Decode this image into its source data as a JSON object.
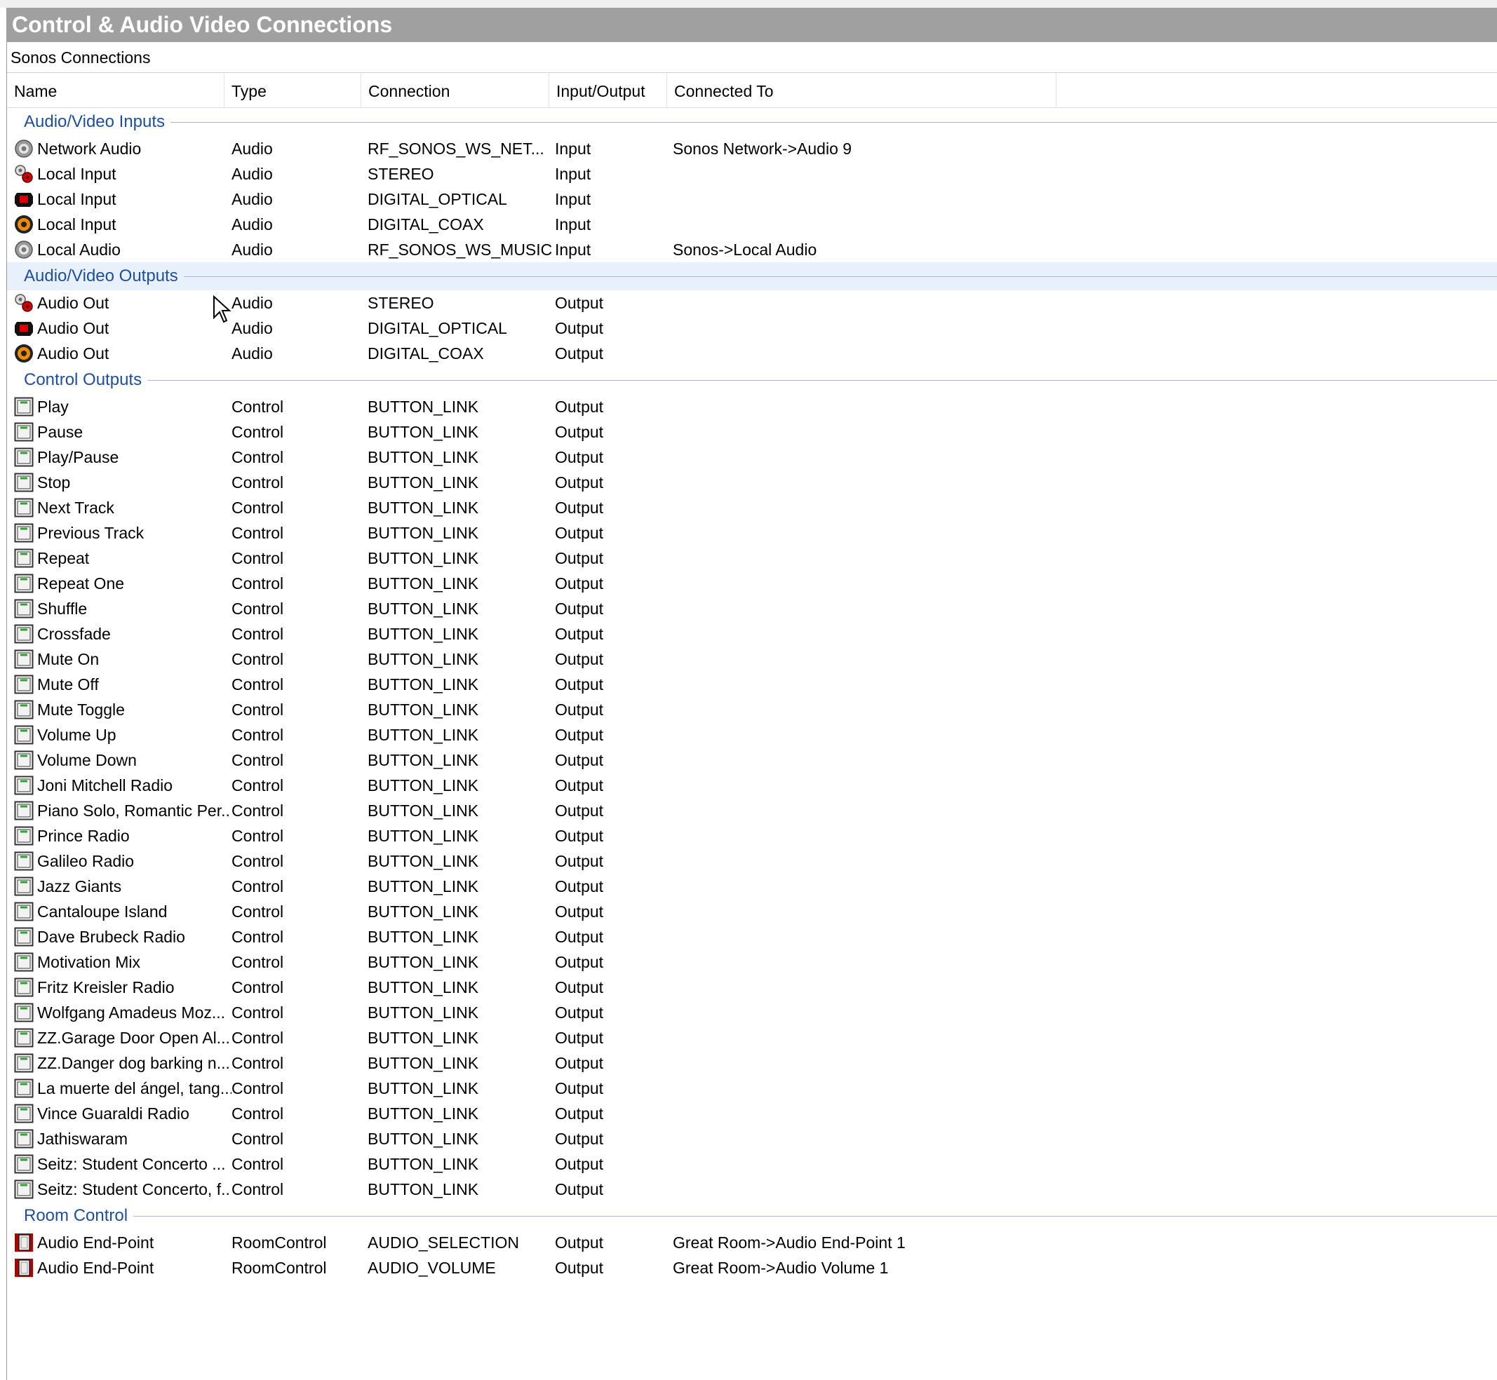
{
  "window": {
    "title": "Control & Audio Video Connections",
    "subtitle": "Sonos Connections"
  },
  "columns": [
    {
      "label": "Name"
    },
    {
      "label": "Type"
    },
    {
      "label": "Connection"
    },
    {
      "label": "Input/Output"
    },
    {
      "label": "Connected To"
    }
  ],
  "groups": [
    {
      "label": "Audio/Video Inputs",
      "rows": [
        {
          "icon": "network-audio-icon",
          "name": "Network Audio",
          "type": "Audio",
          "connection": "RF_SONOS_WS_NET...",
          "io": "Input",
          "connected_to": "Sonos Network->Audio 9"
        },
        {
          "icon": "stereo-jack-icon",
          "name": "Local Input",
          "type": "Audio",
          "connection": "STEREO",
          "io": "Input",
          "connected_to": ""
        },
        {
          "icon": "optical-icon",
          "name": "Local Input",
          "type": "Audio",
          "connection": "DIGITAL_OPTICAL",
          "io": "Input",
          "connected_to": ""
        },
        {
          "icon": "coax-icon",
          "name": "Local Input",
          "type": "Audio",
          "connection": "DIGITAL_COAX",
          "io": "Input",
          "connected_to": ""
        },
        {
          "icon": "network-audio-icon",
          "name": "Local Audio",
          "type": "Audio",
          "connection": "RF_SONOS_WS_MUSIC",
          "io": "Input",
          "connected_to": "Sonos->Local Audio"
        }
      ]
    },
    {
      "label": "Audio/Video Outputs",
      "rows": [
        {
          "icon": "stereo-jack-icon",
          "name": "Audio Out",
          "type": "Audio",
          "connection": "STEREO",
          "io": "Output",
          "connected_to": ""
        },
        {
          "icon": "optical-icon",
          "name": "Audio Out",
          "type": "Audio",
          "connection": "DIGITAL_OPTICAL",
          "io": "Output",
          "connected_to": ""
        },
        {
          "icon": "coax-icon",
          "name": "Audio Out",
          "type": "Audio",
          "connection": "DIGITAL_COAX",
          "io": "Output",
          "connected_to": ""
        }
      ]
    },
    {
      "label": "Control Outputs",
      "rows": [
        {
          "icon": "button-link-icon",
          "name": "Play",
          "type": "Control",
          "connection": "BUTTON_LINK",
          "io": "Output",
          "connected_to": ""
        },
        {
          "icon": "button-link-icon",
          "name": "Pause",
          "type": "Control",
          "connection": "BUTTON_LINK",
          "io": "Output",
          "connected_to": ""
        },
        {
          "icon": "button-link-icon",
          "name": "Play/Pause",
          "type": "Control",
          "connection": "BUTTON_LINK",
          "io": "Output",
          "connected_to": ""
        },
        {
          "icon": "button-link-icon",
          "name": "Stop",
          "type": "Control",
          "connection": "BUTTON_LINK",
          "io": "Output",
          "connected_to": ""
        },
        {
          "icon": "button-link-icon",
          "name": "Next Track",
          "type": "Control",
          "connection": "BUTTON_LINK",
          "io": "Output",
          "connected_to": ""
        },
        {
          "icon": "button-link-icon",
          "name": "Previous Track",
          "type": "Control",
          "connection": "BUTTON_LINK",
          "io": "Output",
          "connected_to": ""
        },
        {
          "icon": "button-link-icon",
          "name": "Repeat",
          "type": "Control",
          "connection": "BUTTON_LINK",
          "io": "Output",
          "connected_to": ""
        },
        {
          "icon": "button-link-icon",
          "name": "Repeat One",
          "type": "Control",
          "connection": "BUTTON_LINK",
          "io": "Output",
          "connected_to": ""
        },
        {
          "icon": "button-link-icon",
          "name": "Shuffle",
          "type": "Control",
          "connection": "BUTTON_LINK",
          "io": "Output",
          "connected_to": ""
        },
        {
          "icon": "button-link-icon",
          "name": "Crossfade",
          "type": "Control",
          "connection": "BUTTON_LINK",
          "io": "Output",
          "connected_to": ""
        },
        {
          "icon": "button-link-icon",
          "name": "Mute On",
          "type": "Control",
          "connection": "BUTTON_LINK",
          "io": "Output",
          "connected_to": ""
        },
        {
          "icon": "button-link-icon",
          "name": "Mute Off",
          "type": "Control",
          "connection": "BUTTON_LINK",
          "io": "Output",
          "connected_to": ""
        },
        {
          "icon": "button-link-icon",
          "name": "Mute Toggle",
          "type": "Control",
          "connection": "BUTTON_LINK",
          "io": "Output",
          "connected_to": ""
        },
        {
          "icon": "button-link-icon",
          "name": "Volume Up",
          "type": "Control",
          "connection": "BUTTON_LINK",
          "io": "Output",
          "connected_to": ""
        },
        {
          "icon": "button-link-icon",
          "name": "Volume Down",
          "type": "Control",
          "connection": "BUTTON_LINK",
          "io": "Output",
          "connected_to": ""
        },
        {
          "icon": "button-link-icon",
          "name": "Joni Mitchell Radio",
          "type": "Control",
          "connection": "BUTTON_LINK",
          "io": "Output",
          "connected_to": ""
        },
        {
          "icon": "button-link-icon",
          "name": "Piano Solo, Romantic Per...",
          "type": "Control",
          "connection": "BUTTON_LINK",
          "io": "Output",
          "connected_to": ""
        },
        {
          "icon": "button-link-icon",
          "name": "Prince Radio",
          "type": "Control",
          "connection": "BUTTON_LINK",
          "io": "Output",
          "connected_to": ""
        },
        {
          "icon": "button-link-icon",
          "name": "Galileo Radio",
          "type": "Control",
          "connection": "BUTTON_LINK",
          "io": "Output",
          "connected_to": ""
        },
        {
          "icon": "button-link-icon",
          "name": "Jazz Giants",
          "type": "Control",
          "connection": "BUTTON_LINK",
          "io": "Output",
          "connected_to": ""
        },
        {
          "icon": "button-link-icon",
          "name": "Cantaloupe Island",
          "type": "Control",
          "connection": "BUTTON_LINK",
          "io": "Output",
          "connected_to": ""
        },
        {
          "icon": "button-link-icon",
          "name": "Dave Brubeck Radio",
          "type": "Control",
          "connection": "BUTTON_LINK",
          "io": "Output",
          "connected_to": ""
        },
        {
          "icon": "button-link-icon",
          "name": "Motivation Mix",
          "type": "Control",
          "connection": "BUTTON_LINK",
          "io": "Output",
          "connected_to": ""
        },
        {
          "icon": "button-link-icon",
          "name": "Fritz Kreisler Radio",
          "type": "Control",
          "connection": "BUTTON_LINK",
          "io": "Output",
          "connected_to": ""
        },
        {
          "icon": "button-link-icon",
          "name": "Wolfgang Amadeus Moz...",
          "type": "Control",
          "connection": "BUTTON_LINK",
          "io": "Output",
          "connected_to": ""
        },
        {
          "icon": "button-link-icon",
          "name": "ZZ.Garage Door Open Al...",
          "type": "Control",
          "connection": "BUTTON_LINK",
          "io": "Output",
          "connected_to": ""
        },
        {
          "icon": "button-link-icon",
          "name": "ZZ.Danger dog barking n...",
          "type": "Control",
          "connection": "BUTTON_LINK",
          "io": "Output",
          "connected_to": ""
        },
        {
          "icon": "button-link-icon",
          "name": "La muerte del ángel, tang...",
          "type": "Control",
          "connection": "BUTTON_LINK",
          "io": "Output",
          "connected_to": ""
        },
        {
          "icon": "button-link-icon",
          "name": "Vince Guaraldi Radio",
          "type": "Control",
          "connection": "BUTTON_LINK",
          "io": "Output",
          "connected_to": ""
        },
        {
          "icon": "button-link-icon",
          "name": "Jathiswaram",
          "type": "Control",
          "connection": "BUTTON_LINK",
          "io": "Output",
          "connected_to": ""
        },
        {
          "icon": "button-link-icon",
          "name": "Seitz: Student Concerto ...",
          "type": "Control",
          "connection": "BUTTON_LINK",
          "io": "Output",
          "connected_to": ""
        },
        {
          "icon": "button-link-icon",
          "name": "Seitz: Student Concerto, f...",
          "type": "Control",
          "connection": "BUTTON_LINK",
          "io": "Output",
          "connected_to": ""
        }
      ]
    },
    {
      "label": "Room Control",
      "rows": [
        {
          "icon": "room-control-icon",
          "name": "Audio End-Point",
          "type": "RoomControl",
          "connection": "AUDIO_SELECTION",
          "io": "Output",
          "connected_to": "Great Room->Audio End-Point 1"
        },
        {
          "icon": "room-control-icon",
          "name": "Audio End-Point",
          "type": "RoomControl",
          "connection": "AUDIO_VOLUME",
          "io": "Output",
          "connected_to": "Great Room->Audio Volume 1"
        }
      ]
    }
  ],
  "colors": {
    "header_bg": "#a0a0a0",
    "group_label": "#1f4e9c",
    "hover_row": "#e8f1fb"
  }
}
